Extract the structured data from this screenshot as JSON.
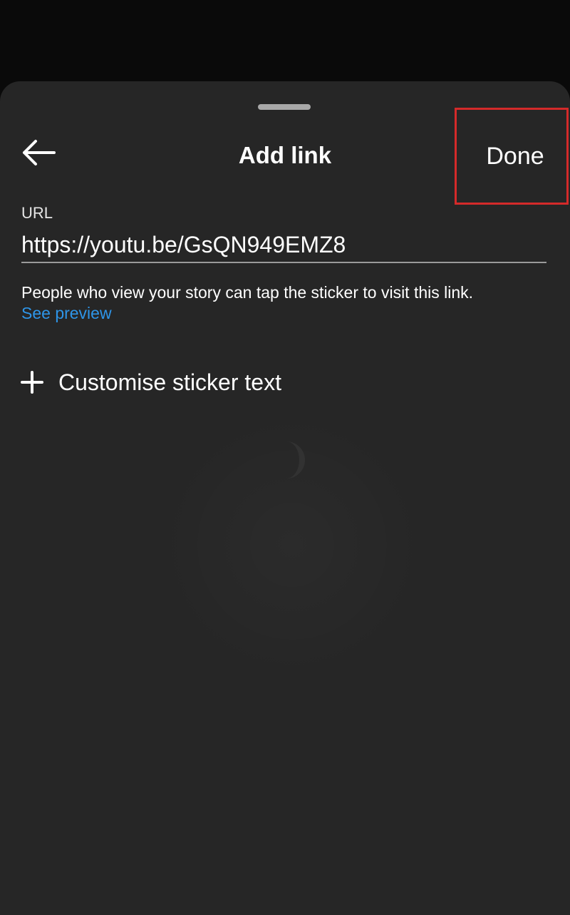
{
  "header": {
    "title": "Add link",
    "back_icon": "arrow-left-icon",
    "done_label": "Done"
  },
  "url_field": {
    "label": "URL",
    "value": "https://youtu.be/GsQN949EMZ8"
  },
  "helper": {
    "text": "People who view your story can tap the sticker to visit this link.",
    "preview_link": "See preview"
  },
  "customise": {
    "icon": "plus-icon",
    "label": "Customise sticker text"
  },
  "colors": {
    "sheet_background": "#262626",
    "link_blue": "#2e95e8",
    "highlight_box": "#d42a2a"
  }
}
